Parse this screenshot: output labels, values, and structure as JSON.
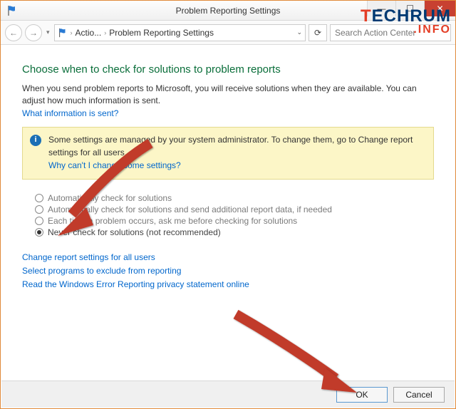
{
  "titlebar": {
    "title": "Problem Reporting Settings"
  },
  "nav": {
    "crumb1": "Actio...",
    "sep": "›",
    "crumb2": "Problem Reporting Settings",
    "search_placeholder": "Search Action Center"
  },
  "heading": "Choose when to check for solutions to problem reports",
  "lede": "When you send problem reports to Microsoft, you will receive solutions when they are available. You can adjust how much information is sent.",
  "info_link": "What information is sent?",
  "notice": {
    "line1": "Some settings are managed by your system administrator. To change them, go to Change report settings for all users.",
    "line2": "Why can't I change some settings?"
  },
  "options": [
    {
      "label": "Automatically check for solutions",
      "selected": false
    },
    {
      "label": "Automatically check for solutions and send additional report data, if needed",
      "selected": false
    },
    {
      "label": "Each time a problem occurs, ask me before checking for solutions",
      "selected": false
    },
    {
      "label": "Never check for solutions (not recommended)",
      "selected": true
    }
  ],
  "links": {
    "a": "Change report settings for all users",
    "b": "Select programs to exclude from reporting",
    "c": "Read the Windows Error Reporting privacy statement online"
  },
  "buttons": {
    "ok": "OK",
    "cancel": "Cancel"
  },
  "watermark": {
    "brand_pre": "T",
    "brand_rest": "ECHRUM",
    "sub": ".INFO"
  }
}
